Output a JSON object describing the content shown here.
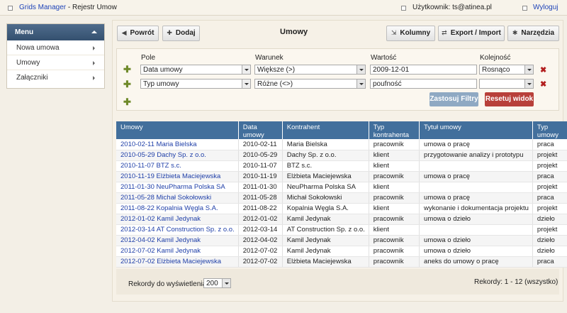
{
  "topbar": {
    "app_link": "Grids Manager",
    "app_rest": " - Rejestr Umow",
    "user": "Użytkownik: ts@atinea.pl",
    "logout": "Wyloguj"
  },
  "sidebar": {
    "title": "Menu",
    "items": [
      {
        "label": "Nowa umowa"
      },
      {
        "label": "Umowy"
      },
      {
        "label": "Załączniki"
      }
    ]
  },
  "toolbar": {
    "back": "Powrót",
    "add": "Dodaj",
    "columns": "Kolumny",
    "export": "Export / Import",
    "tools": "Narzędzia"
  },
  "page_title": "Umowy",
  "filters": {
    "headers": {
      "field": "Pole",
      "condition": "Warunek",
      "value": "Wartość",
      "order": "Kolejność"
    },
    "rows": [
      {
        "field": "Data umowy",
        "condition": "Większe (>)",
        "value": "2009-12-01",
        "order": "Rosnąco"
      },
      {
        "field": "Typ umowy",
        "condition": "Różne (<>)",
        "value": "poufność",
        "order": ""
      }
    ],
    "apply": "Zastosuj Filtry",
    "reset": "Resetuj widok"
  },
  "table": {
    "headers": [
      "Umowy",
      "Data umowy",
      "Kontrahent",
      "Typ kontrahenta",
      "Tytuł umowy",
      "Typ umowy"
    ],
    "rows": [
      [
        "2010-02-11 Maria Bielska",
        "2010-02-11",
        "Maria Bielska",
        "pracownik",
        "umowa o pracę",
        "praca"
      ],
      [
        "2010-05-29 Dachy Sp. z o.o.",
        "2010-05-29",
        "Dachy Sp. z o.o.",
        "klient",
        "przygotowanie analizy i prototypu",
        "projekt"
      ],
      [
        "2010-11-07 BTZ s.c.",
        "2010-11-07",
        "BTZ s.c.",
        "klient",
        "",
        "projekt"
      ],
      [
        "2010-11-19 Elżbieta Maciejewska",
        "2010-11-19",
        "Elżbieta Maciejewska",
        "pracownik",
        "umowa o pracę",
        "praca"
      ],
      [
        "2011-01-30 NeuPharma Polska SA",
        "2011-01-30",
        "NeuPharma Polska SA",
        "klient",
        "",
        "projekt"
      ],
      [
        "2011-05-28 Michał Sokołowski",
        "2011-05-28",
        "Michał Sokołowski",
        "pracownik",
        "umowa o pracę",
        "praca"
      ],
      [
        "2011-08-22 Kopalnia Węgla S.A.",
        "2011-08-22",
        "Kopalnia Węgla S.A.",
        "klient",
        "wykonanie i dokumentacja projektu",
        "projekt"
      ],
      [
        "2012-01-02 Kamil Jedynak",
        "2012-01-02",
        "Kamil Jedynak",
        "pracownik",
        "umowa o dzieło",
        "dzieło"
      ],
      [
        "2012-03-14 AT Construction Sp. z o.o.",
        "2012-03-14",
        "AT Construction Sp. z o.o.",
        "klient",
        "",
        "projekt"
      ],
      [
        "2012-04-02 Kamil Jedynak",
        "2012-04-02",
        "Kamil Jedynak",
        "pracownik",
        "umowa o dzieło",
        "dzieło"
      ],
      [
        "2012-07-02 Kamil Jedynak",
        "2012-07-02",
        "Kamil Jedynak",
        "pracownik",
        "umowa o dzieło",
        "dzieło"
      ],
      [
        "2012-07-02 Elżbieta Maciejewska",
        "2012-07-02",
        "Elżbieta Maciejewska",
        "pracownik",
        "aneks do umowy o pracę",
        "praca"
      ]
    ]
  },
  "footer": {
    "records_label": "Rekordy do wyświetlenia:",
    "records_per_page": "200",
    "records_count": "Rekordy: 1 - 12 (wszystko)"
  },
  "colors": {
    "header_blue": "#426f9c",
    "apply_button": "#8fa9c3",
    "reset_button": "#b8403a",
    "link": "#1f3fa8"
  }
}
